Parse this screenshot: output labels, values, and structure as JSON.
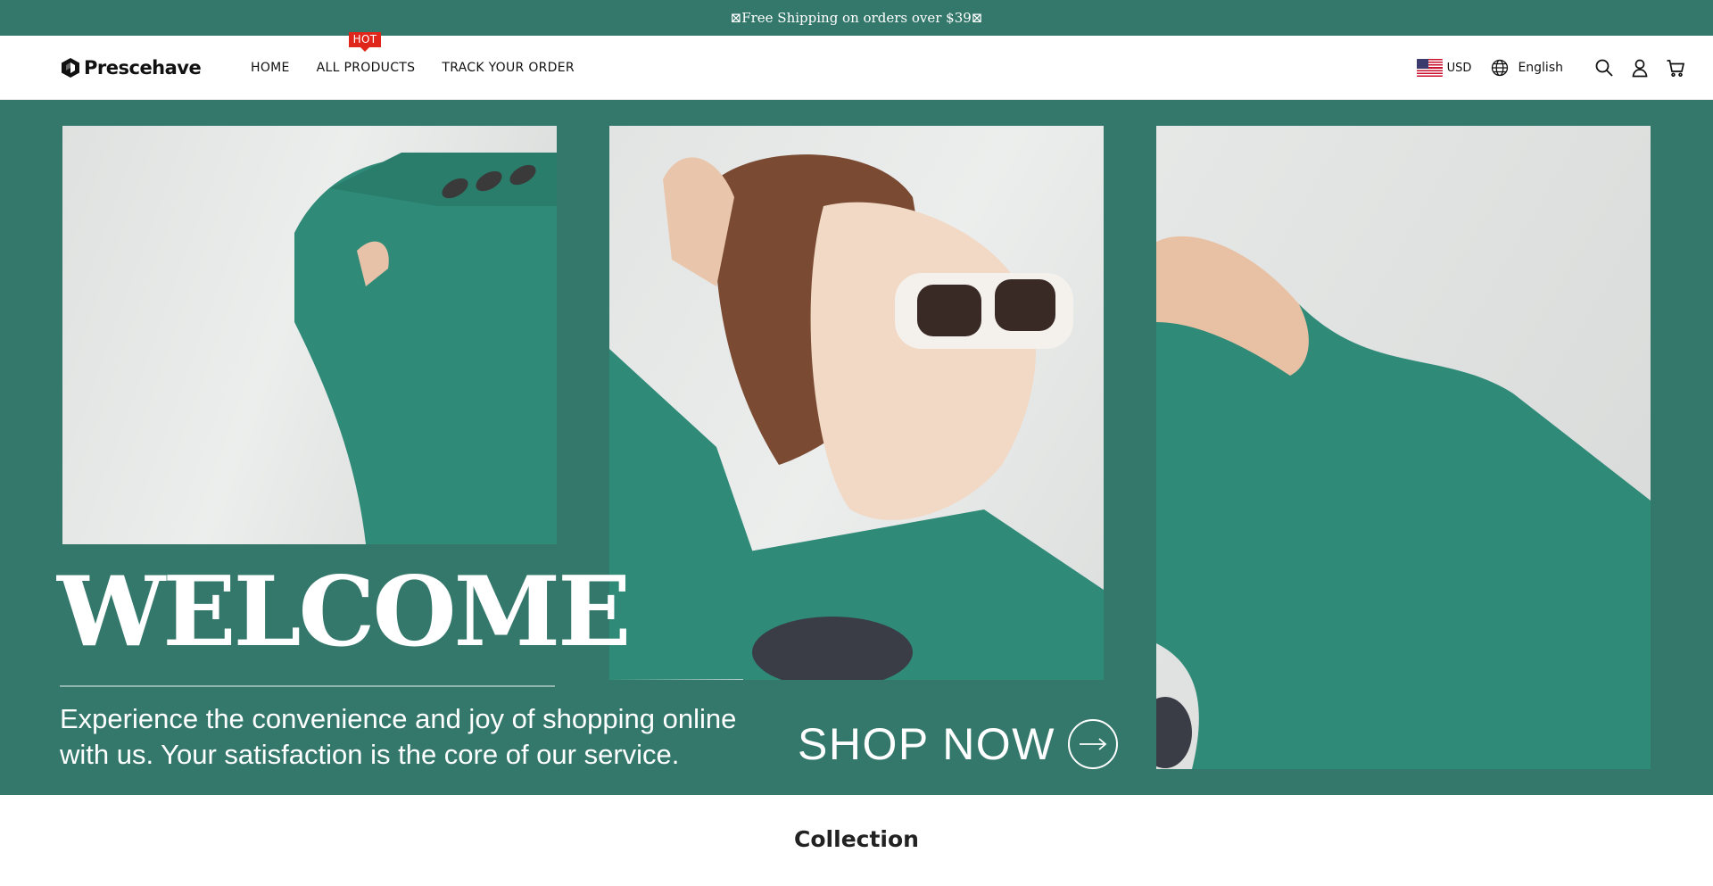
{
  "announcement": {
    "text": "⊠Free Shipping on orders over $39⊠"
  },
  "header": {
    "logo_text": "Prescehave",
    "nav": [
      {
        "label": "HOME"
      },
      {
        "label": "ALL PRODUCTS",
        "badge": "HOT"
      },
      {
        "label": "TRACK YOUR ORDER"
      }
    ],
    "currency": "USD",
    "language": "English",
    "icons": [
      "globe-icon",
      "search-icon",
      "account-icon",
      "cart-icon"
    ]
  },
  "hero": {
    "headline": "WELCOME",
    "tagline": "Experience the convenience and joy of shopping online with us. Your satisfaction is the core of our service.",
    "cta_label": "SHOP NOW",
    "background_color": "#34786c",
    "garment_color": "#2f8a78"
  },
  "section": {
    "title": "Collection"
  },
  "colors": {
    "accent": "#34786c",
    "badge": "#e0251b",
    "text": "#111111"
  }
}
